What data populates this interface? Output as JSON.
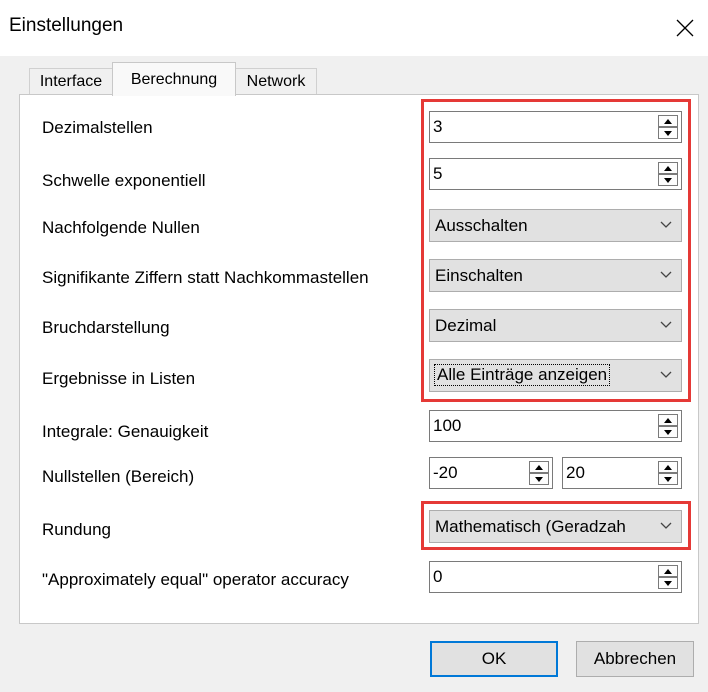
{
  "window": {
    "title": "Einstellungen"
  },
  "tabs": [
    "Interface",
    "Berechnung",
    "Network"
  ],
  "settings": {
    "decimal_places": {
      "label": "Dezimalstellen",
      "value": "3"
    },
    "exponential_threshold": {
      "label": "Schwelle exponentiell",
      "value": "5"
    },
    "trailing_zeros": {
      "label": "Nachfolgende Nullen",
      "value": "Ausschalten"
    },
    "significant_digits": {
      "label": "Signifikante Ziffern statt Nachkommastellen",
      "value": "Einschalten"
    },
    "fraction_display": {
      "label": "Bruchdarstellung",
      "value": "Dezimal"
    },
    "list_results": {
      "label": "Ergebnisse in Listen",
      "value": "Alle Einträge anzeigen"
    },
    "integral_accuracy": {
      "label": "Integrale: Genauigkeit",
      "value": "100"
    },
    "roots_range": {
      "label": "Nullstellen (Bereich)",
      "min": "-20",
      "max": "20"
    },
    "rounding": {
      "label": "Rundung",
      "value": "Mathematisch (Geradzah"
    },
    "approx_equal": {
      "label": "\"Approximately equal\" operator accuracy",
      "value": "0"
    }
  },
  "buttons": {
    "ok": "OK",
    "cancel": "Abbrechen"
  },
  "colors": {
    "highlight": "#e53936",
    "default_button_border": "#0078d7"
  }
}
